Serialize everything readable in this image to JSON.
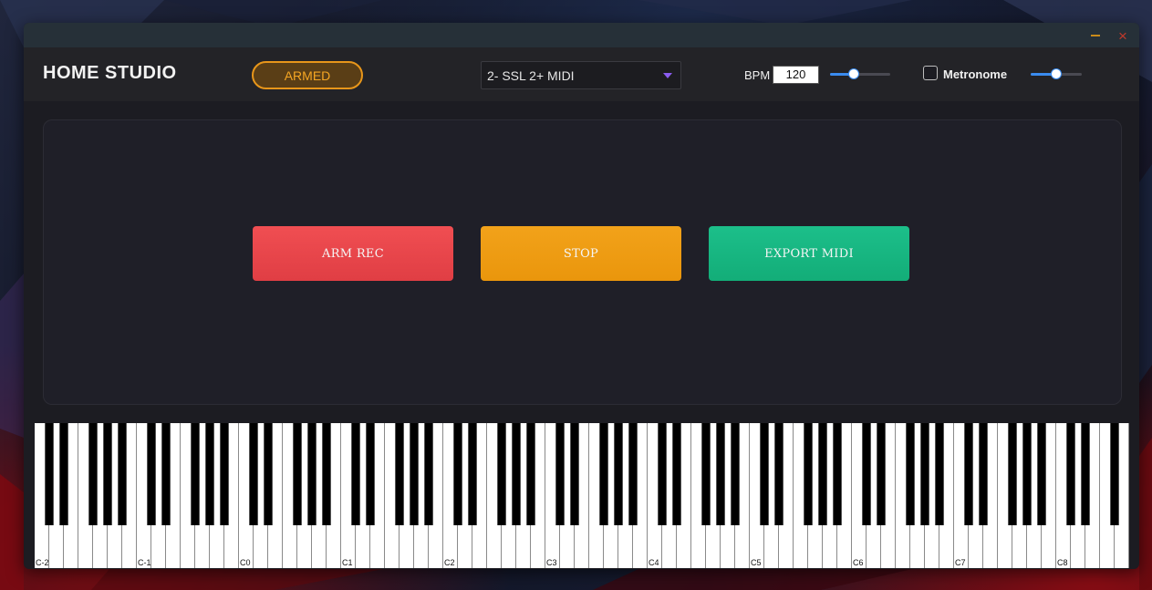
{
  "window": {
    "title": "HOME STUDIO",
    "status_pill": "ARMED",
    "minimize_icon": "minimize-icon",
    "close_icon": "close-icon",
    "close_symbol": "×"
  },
  "midi_device": {
    "selected": "2- SSL 2+ MIDI"
  },
  "bpm": {
    "label": "BPM",
    "value": "120",
    "slider_level": 0.4
  },
  "metronome": {
    "label": "Metronome",
    "checked": false,
    "volume_level": 0.5
  },
  "actions": {
    "arm": "ARM REC",
    "stop": "STOP",
    "export": "EXPORT MIDI"
  },
  "keyboard": {
    "octave_labels": [
      "C-2",
      "C-1",
      "C0",
      "C1",
      "C2",
      "C3",
      "C4",
      "C5",
      "C6",
      "C7",
      "C8"
    ]
  },
  "colors": {
    "accent_orange": "#f5a623",
    "rec_red": "#e8454a",
    "stop_orange": "#f09d15",
    "export_green": "#17b681",
    "slider_blue": "#3a8cf0",
    "caret_purple": "#8a5cf0",
    "close_red": "#c0392b"
  }
}
